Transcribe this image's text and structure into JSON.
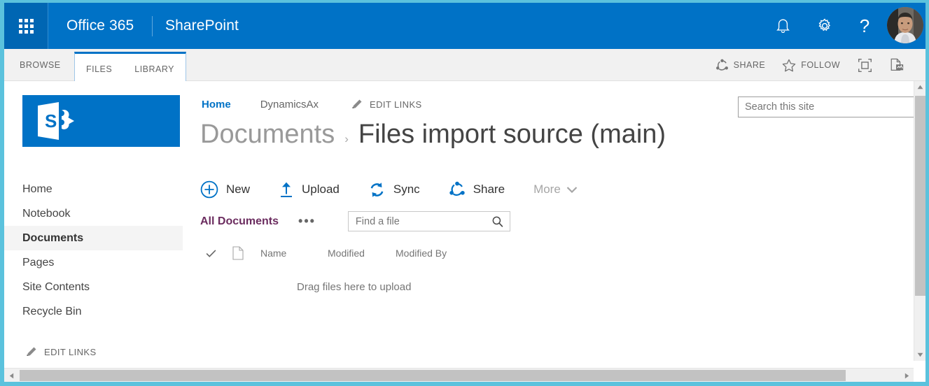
{
  "suite_bar": {
    "waffle_icon": "app-launcher-waffle-icon",
    "brand": "Office 365",
    "app_name": "SharePoint",
    "icons": {
      "notifications": "bell-icon",
      "settings": "gear-icon",
      "help": "?",
      "avatar": "user-avatar"
    }
  },
  "ribbon": {
    "browse_tab": "BROWSE",
    "tabs": [
      {
        "label": "FILES"
      },
      {
        "label": "LIBRARY"
      }
    ],
    "commands": [
      {
        "label": "SHARE",
        "icon": "share-icon"
      },
      {
        "label": "FOLLOW",
        "icon": "star-icon"
      }
    ],
    "focus_icon": "focus-on-content-icon",
    "sync_page_icon": "page-sync-icon"
  },
  "site": {
    "logo": "sharepoint-logo",
    "quick_launch": [
      {
        "label": "Home",
        "selected": false
      },
      {
        "label": "Notebook",
        "selected": false
      },
      {
        "label": "Documents",
        "selected": true
      },
      {
        "label": "Pages",
        "selected": false
      },
      {
        "label": "Site Contents",
        "selected": false
      },
      {
        "label": "Recycle Bin",
        "selected": false
      }
    ],
    "edit_links": "EDIT LINKS"
  },
  "top_nav": {
    "home": "Home",
    "dynamicsax": "DynamicsAx",
    "edit_links": "EDIT LINKS"
  },
  "search": {
    "placeholder": "Search this site",
    "value": ""
  },
  "page_title": {
    "parent": "Documents",
    "separator": "›",
    "current": "Files import source (main)"
  },
  "command_bar": {
    "items": [
      {
        "label": "New",
        "icon": "plus-circle-icon"
      },
      {
        "label": "Upload",
        "icon": "upload-arrow-icon"
      },
      {
        "label": "Sync",
        "icon": "sync-icon"
      },
      {
        "label": "Share",
        "icon": "share-icon"
      }
    ],
    "more": "More"
  },
  "views": {
    "current_view": "All Documents",
    "ellipsis": "•••",
    "find_placeholder": "Find a file",
    "find_value": ""
  },
  "file_list": {
    "columns": [
      {
        "label": "Name"
      },
      {
        "label": "Modified"
      },
      {
        "label": "Modified By"
      }
    ],
    "empty_message": "Drag files here to upload",
    "rows": []
  },
  "colors": {
    "suite_blue": "#0072c6",
    "waffle_blue": "#0066b3",
    "accent_link": "#0072c6",
    "view_purple": "#6b2c5f",
    "frame_teal": "#5bc2dd"
  }
}
